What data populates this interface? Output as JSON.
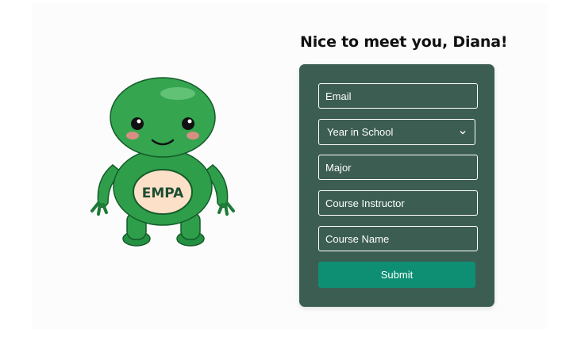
{
  "greeting": "Nice to meet you, Diana!",
  "mascot": {
    "badge_text": "EMPA",
    "body_color": "#2f9e4a",
    "badge_color": "#fde0c8"
  },
  "form": {
    "email_placeholder": "Email",
    "year_select_value": "Year in School",
    "major_placeholder": "Major",
    "instructor_placeholder": "Course Instructor",
    "course_name_placeholder": "Course Name",
    "submit_label": "Submit"
  },
  "colors": {
    "card_bg": "#3c5e52",
    "submit_bg": "#0e8f74"
  }
}
